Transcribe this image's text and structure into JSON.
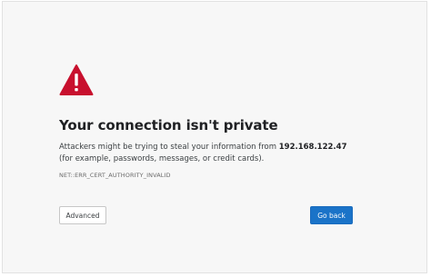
{
  "page": {
    "title": "Your connection isn't private",
    "message_prefix": "Attackers might be trying to steal your information from ",
    "host": "192.168.122.47",
    "message_suffix": " (for example, passwords, messages, or credit cards).",
    "error_code": "NET::ERR_CERT_AUTHORITY_INVALID"
  },
  "buttons": {
    "advanced_label": "Advanced",
    "back_label": "Go back"
  },
  "icon": {
    "name": "warning-triangle-icon",
    "color": "#c8102e"
  },
  "colors": {
    "background": "#f7f7f7",
    "primary_button": "#1a73c8",
    "text": "#202124"
  }
}
